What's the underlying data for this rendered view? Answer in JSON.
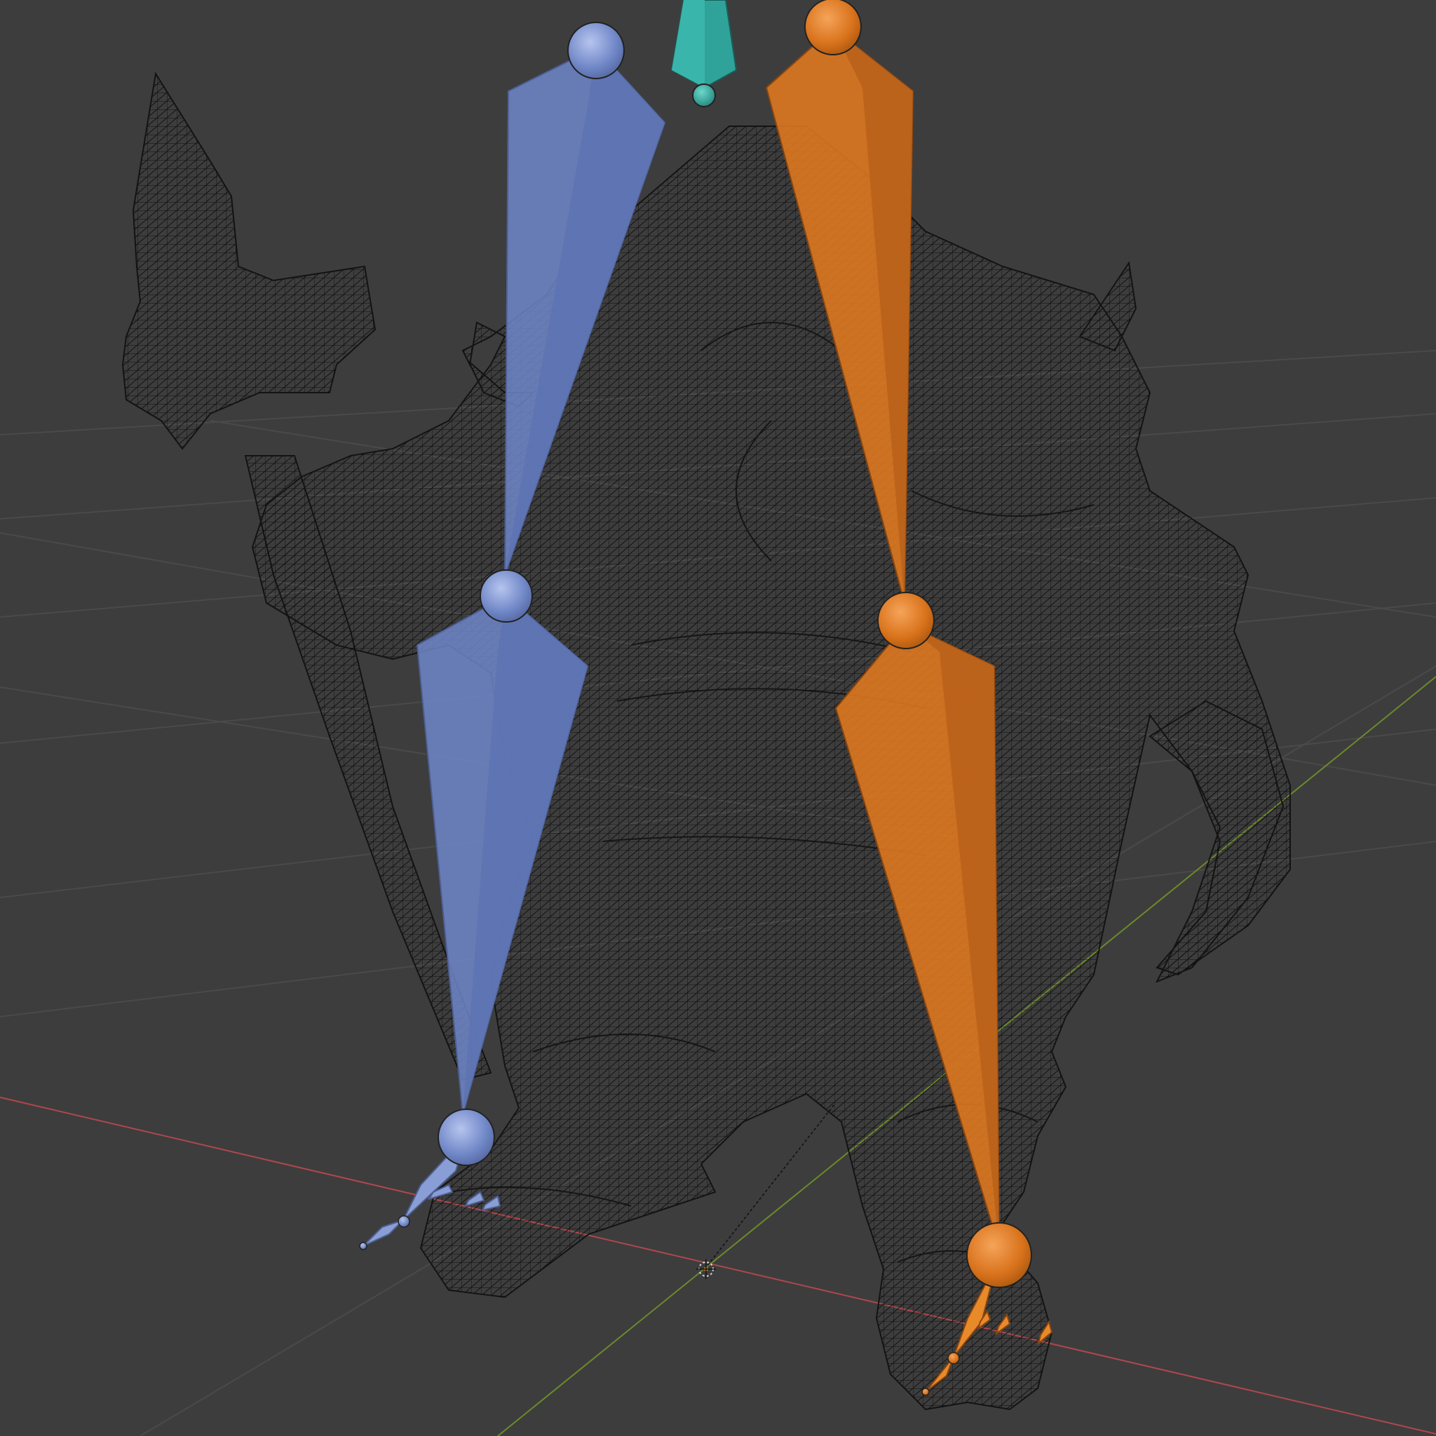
{
  "viewport": {
    "background": "#3d3d3d",
    "grid_color": "#4a4a4a",
    "x_axis_color": "#b0474d",
    "y_axis_color": "#6b8a2b",
    "wire_color": "#111111"
  },
  "armature": {
    "left_leg_color": "#6f86c9",
    "right_leg_color": "#e07a1f",
    "root_bone_color": "#2fa39a"
  },
  "icons": {
    "origin": "3d-cursor-icon"
  }
}
